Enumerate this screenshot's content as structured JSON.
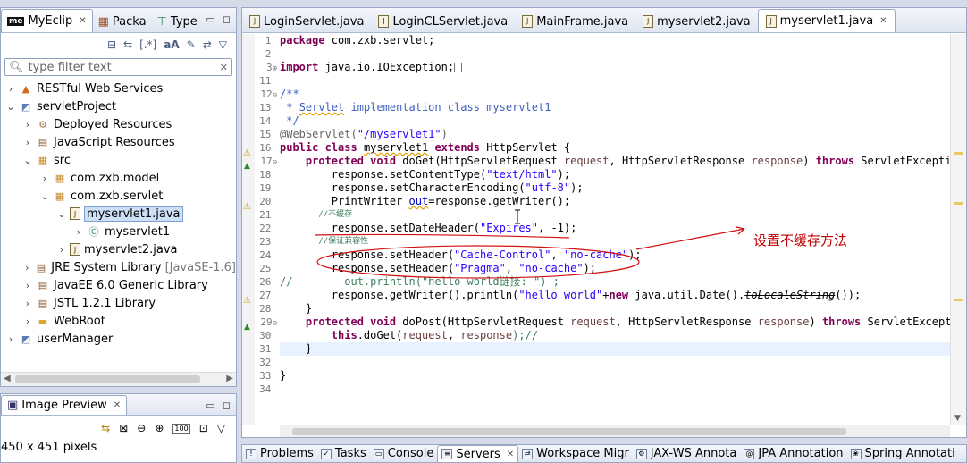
{
  "left_panel": {
    "tabs": [
      {
        "label": "MyEclip",
        "icon": "me",
        "active": true
      },
      {
        "label": "Packa",
        "icon": "package-icon",
        "active": false
      },
      {
        "label": "Type",
        "icon": "type-hierarchy-icon",
        "active": false
      }
    ],
    "filter_placeholder": "type filter text",
    "tree": [
      {
        "label": "RESTful Web Services",
        "depth": 0,
        "twisty": "›",
        "icon": "rest-icon"
      },
      {
        "label": "servletProject",
        "depth": 0,
        "twisty": "⌄",
        "icon": "project-icon"
      },
      {
        "label": "Deployed Resources",
        "depth": 1,
        "twisty": "›",
        "icon": "deployed-icon"
      },
      {
        "label": "JavaScript Resources",
        "depth": 1,
        "twisty": "›",
        "icon": "library-icon"
      },
      {
        "label": "src",
        "depth": 1,
        "twisty": "⌄",
        "icon": "src-folder-icon"
      },
      {
        "label": "com.zxb.model",
        "depth": 2,
        "twisty": "›",
        "icon": "package-icon"
      },
      {
        "label": "com.zxb.servlet",
        "depth": 2,
        "twisty": "⌄",
        "icon": "package-icon"
      },
      {
        "label": "myservlet1.java",
        "depth": 3,
        "twisty": "⌄",
        "icon": "java-file-icon",
        "selected": true
      },
      {
        "label": "myservlet1",
        "depth": 4,
        "twisty": "›",
        "icon": "class-icon"
      },
      {
        "label": "myservlet2.java",
        "depth": 3,
        "twisty": "›",
        "icon": "java-file-icon"
      },
      {
        "label": "JRE System Library",
        "suffix": "[JavaSE-1.6]",
        "depth": 1,
        "twisty": "›",
        "icon": "library-icon"
      },
      {
        "label": "JavaEE 6.0 Generic Library",
        "depth": 1,
        "twisty": "›",
        "icon": "library-icon"
      },
      {
        "label": "JSTL 1.2.1 Library",
        "depth": 1,
        "twisty": "›",
        "icon": "library-icon"
      },
      {
        "label": "WebRoot",
        "depth": 1,
        "twisty": "›",
        "icon": "folder-icon"
      },
      {
        "label": "userManager",
        "depth": 0,
        "twisty": "›",
        "icon": "project-icon"
      }
    ]
  },
  "image_preview": {
    "tab_label": "Image Preview",
    "size_text": "450 x 451 pixels"
  },
  "editor": {
    "tabs": [
      {
        "label": "LoginServlet.java",
        "active": false
      },
      {
        "label": "LoginCLServlet.java",
        "active": false
      },
      {
        "label": "MainFrame.java",
        "active": false
      },
      {
        "label": "myservlet2.java",
        "active": false
      },
      {
        "label": "myservlet1.java",
        "active": true
      }
    ],
    "lines": [
      {
        "n": "1",
        "mark": ""
      },
      {
        "n": "2",
        "mark": ""
      },
      {
        "n": "3",
        "mark": "⊕"
      },
      {
        "n": "11",
        "mark": ""
      },
      {
        "n": "12",
        "mark": "⊖"
      },
      {
        "n": "13",
        "mark": ""
      },
      {
        "n": "14",
        "mark": ""
      },
      {
        "n": "15",
        "mark": ""
      },
      {
        "n": "16",
        "mark": ""
      },
      {
        "n": "17",
        "mark": "⊖"
      },
      {
        "n": "18",
        "mark": ""
      },
      {
        "n": "19",
        "mark": ""
      },
      {
        "n": "20",
        "mark": ""
      },
      {
        "n": "21",
        "mark": ""
      },
      {
        "n": "22",
        "mark": ""
      },
      {
        "n": "23",
        "mark": ""
      },
      {
        "n": "24",
        "mark": ""
      },
      {
        "n": "25",
        "mark": ""
      },
      {
        "n": "26",
        "mark": ""
      },
      {
        "n": "27",
        "mark": ""
      },
      {
        "n": "28",
        "mark": ""
      },
      {
        "n": "29",
        "mark": "⊖"
      },
      {
        "n": "30",
        "mark": ""
      },
      {
        "n": "31",
        "mark": ""
      },
      {
        "n": "32",
        "mark": ""
      },
      {
        "n": "33",
        "mark": ""
      },
      {
        "n": "34",
        "mark": ""
      }
    ],
    "code": {
      "l1_kw": "package",
      "l1_rest": " com.zxb.servlet;",
      "l3_kw": "import",
      "l3_rest": " java.io.IOException;",
      "l12": "/**",
      "l13_a": " * ",
      "l13_b": "Servlet",
      "l13_c": " implementation class myservlet1",
      "l14": " */",
      "l15_a": "@WebServlet(",
      "l15_b": "\"/myservlet1\"",
      "l15_c": ")",
      "l16_kw1": "public",
      "l16_kw2": "class",
      "l16_name": "myservlet1",
      "l16_kw3": "extends",
      "l16_rest": " HttpServlet {",
      "l17_kw1": "protected",
      "l17_kw2": "void",
      "l17_a": " doGet(HttpServletRequest ",
      "l17_p1": "request",
      "l17_b": ", HttpServletResponse ",
      "l17_p2": "response",
      "l17_c": ") ",
      "l17_kw3": "throws",
      "l17_d": " ServletExceptio",
      "l18_a": "        response.setContentType(",
      "l18_s": "\"text/html\"",
      "l18_b": ");",
      "l19_a": "        response.setCharacterEncoding(",
      "l19_s": "\"utf-8\"",
      "l19_b": ");",
      "l20_a": "        PrintWriter ",
      "l20_v": "out",
      "l20_b": "=response.getWriter();",
      "l21": "        //不缓存",
      "l22_a": "        response.setDateHeader(",
      "l22_s": "\"Expires\"",
      "l22_b": ", -1);",
      "l23": "        //保证兼容性",
      "l24_a": "        response.setHeader(",
      "l24_s1": "\"Cache-Control\"",
      "l24_b": ", ",
      "l24_s2": "\"no-cache\"",
      "l24_c": ");",
      "l25_a": "        response.setHeader(",
      "l25_s1": "\"Pragma\"",
      "l25_b": ", ",
      "l25_s2": "\"no-cache\"",
      "l25_c": ");",
      "l26": "//        out.println(\"hello world链接: \") ;",
      "l27_a": "        response.getWriter().println(",
      "l27_s": "\"hello world\"",
      "l27_b": "+",
      "l27_kw": "new",
      "l27_c": " java.util.Date().",
      "l27_d": "toLocaleString",
      "l27_e": "());",
      "l28": "    }",
      "l29_kw1": "protected",
      "l29_kw2": "void",
      "l29_a": " doPost(HttpServletRequest ",
      "l29_p1": "request",
      "l29_b": ", HttpServletResponse ",
      "l29_p2": "response",
      "l29_c": ") ",
      "l29_kw3": "throws",
      "l29_d": " ServletExceptic",
      "l30_kw": "this",
      "l30_a": ".doGet(",
      "l30_p1": "request",
      "l30_b": ", ",
      "l30_p2": "response",
      "l30_c": ");//",
      "l31": "    }",
      "l33": "}"
    }
  },
  "annotation_text": "设置不缓存方法",
  "bottom_tabs": [
    {
      "label": "Problems",
      "active": false
    },
    {
      "label": "Tasks",
      "active": false
    },
    {
      "label": "Console",
      "active": false
    },
    {
      "label": "Servers",
      "active": true
    },
    {
      "label": "Workspace Migr",
      "active": false
    },
    {
      "label": "JAX-WS Annota",
      "active": false
    },
    {
      "label": "JPA Annotation",
      "active": false
    },
    {
      "label": "Spring Annotati",
      "active": false
    }
  ]
}
